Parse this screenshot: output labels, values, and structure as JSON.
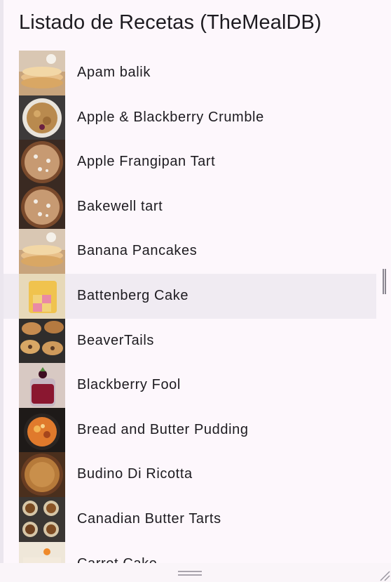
{
  "app": {
    "title": "Listado de Recetas (TheMealDB)"
  },
  "recipes": [
    {
      "name": "Apam balik",
      "icon": "pancake-stack-photo"
    },
    {
      "name": "Apple & Blackberry Crumble",
      "icon": "crumble-dish-photo"
    },
    {
      "name": "Apple Frangipan Tart",
      "icon": "tart-photo"
    },
    {
      "name": "Bakewell tart",
      "icon": "tart-photo"
    },
    {
      "name": "Banana Pancakes",
      "icon": "pancake-stack-photo"
    },
    {
      "name": "Battenberg Cake",
      "icon": "checkered-cake-photo"
    },
    {
      "name": "BeaverTails",
      "icon": "pastry-tray-photo"
    },
    {
      "name": "Blackberry Fool",
      "icon": "dessert-glass-photo"
    },
    {
      "name": "Bread and Butter Pudding",
      "icon": "pudding-skillet-photo"
    },
    {
      "name": "Budino Di Ricotta",
      "icon": "baked-cake-photo"
    },
    {
      "name": "Canadian Butter Tarts",
      "icon": "tartlets-tray-photo"
    },
    {
      "name": "Carrot Cake",
      "icon": "layer-cake-photo"
    }
  ],
  "highlighted_row": "Battenberg Cake"
}
